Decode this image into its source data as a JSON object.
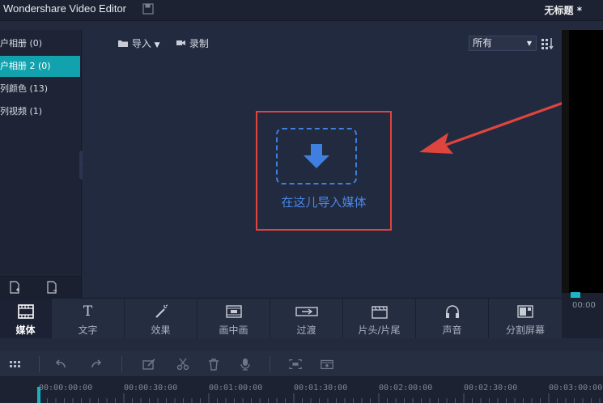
{
  "app": {
    "title": "Wondershare Video Editor",
    "document_title": "无标题 *"
  },
  "albums": [
    {
      "label": "户相册 (0)"
    },
    {
      "label": "户相册 2 (0)",
      "selected": true
    },
    {
      "label": "列颜色 (13)"
    },
    {
      "label": "列视频 (1)"
    }
  ],
  "media_toolbar": {
    "import_label": "导入",
    "record_label": "录制",
    "filter_value": "所有"
  },
  "dropzone": {
    "label": "在这儿导入媒体"
  },
  "tabs": [
    {
      "label": "媒体",
      "icon": "film-icon",
      "active": true
    },
    {
      "label": "文字",
      "icon": "text-icon"
    },
    {
      "label": "效果",
      "icon": "magic-wand-icon"
    },
    {
      "label": "画中画",
      "icon": "pip-icon"
    },
    {
      "label": "过渡",
      "icon": "transition-icon"
    },
    {
      "label": "片头/片尾",
      "icon": "clapper-icon"
    },
    {
      "label": "声音",
      "icon": "headphones-icon"
    },
    {
      "label": "分割屏幕",
      "icon": "split-screen-icon"
    }
  ],
  "preview": {
    "time": "00:00"
  },
  "ruler": {
    "labels": [
      "00:00:00:00",
      "00:00:30:00",
      "00:01:00:00",
      "00:01:30:00",
      "00:02:00:00",
      "00:02:30:00",
      "00:03:00:00"
    ]
  },
  "colors": {
    "accent": "#12a2ad",
    "dropzone_blue": "#3e7fe0",
    "highlight_red": "#e0443e"
  }
}
